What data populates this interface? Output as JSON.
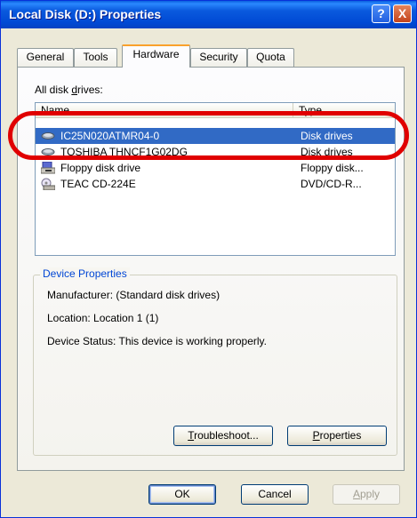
{
  "window": {
    "title": "Local Disk (D:) Properties"
  },
  "titlebar_buttons": {
    "help": "?",
    "close": "X"
  },
  "tabs": [
    {
      "label": "General"
    },
    {
      "label": "Tools"
    },
    {
      "label": "Hardware",
      "active": true
    },
    {
      "label": "Security"
    },
    {
      "label": "Quota"
    }
  ],
  "disk_list": {
    "label_prefix": "All disk ",
    "label_underlined": "d",
    "label_suffix": "rives:",
    "columns": [
      "Name",
      "Type"
    ],
    "rows": [
      {
        "name": "IC25N020ATMR04-0",
        "type": "Disk drives",
        "icon": "hard-disk-icon",
        "selected": true
      },
      {
        "name": "TOSHIBA THNCF1G02DG",
        "type": "Disk drives",
        "icon": "hard-disk-icon"
      },
      {
        "name": "Floppy disk drive",
        "type": "Floppy disk...",
        "icon": "floppy-drive-icon"
      },
      {
        "name": "TEAC CD-224E",
        "type": "DVD/CD-R...",
        "icon": "cd-drive-icon"
      }
    ]
  },
  "device_properties": {
    "title": "Device Properties",
    "manufacturer": "Manufacturer: (Standard disk drives)",
    "location": "Location: Location 1 (1)",
    "status": "Device Status: This device is working properly."
  },
  "buttons": {
    "troubleshoot_mnemonic": "T",
    "troubleshoot_rest": "roubleshoot...",
    "properties_mnemonic": "P",
    "properties_rest": "roperties",
    "ok": "OK",
    "cancel": "Cancel",
    "apply_mnemonic": "A",
    "apply_rest": "pply"
  },
  "colors": {
    "titlebar": "#0a5ade",
    "selection": "#316ac5",
    "highlight_annotation": "#e00000",
    "tab_accent": "#f9a12c"
  }
}
